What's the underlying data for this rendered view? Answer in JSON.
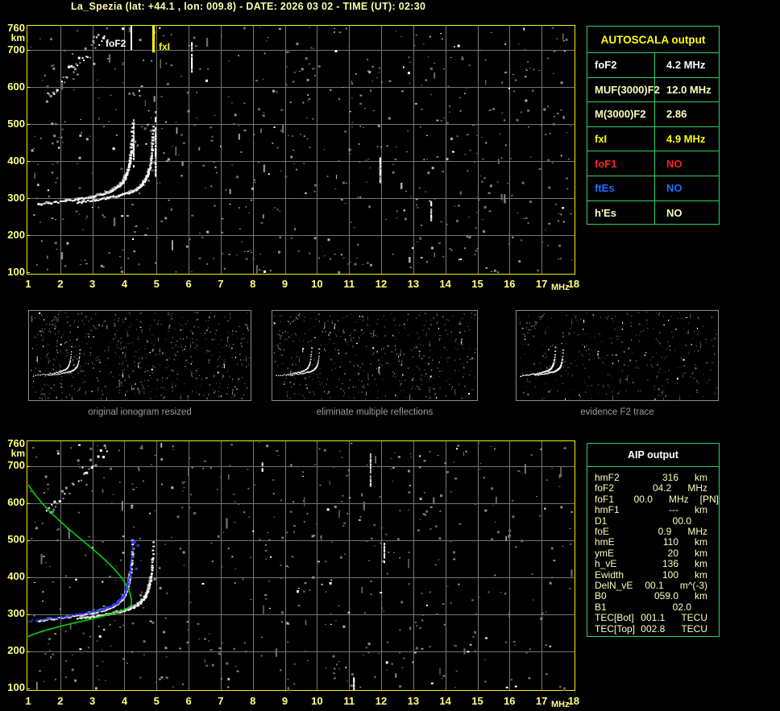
{
  "title": "La_Spezia (lat: +44.1 , lon: 009.8) - DATE: 2026 03 02 - TIME (UT): 02:30",
  "axes": {
    "x_unit": "MHz",
    "y_unit": "km",
    "x_ticks": [
      "1",
      "2",
      "3",
      "4",
      "5",
      "6",
      "7",
      "8",
      "9",
      "10",
      "11",
      "12",
      "13",
      "14",
      "15",
      "16",
      "17",
      "18"
    ],
    "y_ticks": [
      "760",
      "700",
      "600",
      "500",
      "400",
      "300",
      "200",
      "100"
    ]
  },
  "markers": {
    "foF2_label": "foF2",
    "fxI_label": "fxI",
    "foF2_freq_mhz": 4.2,
    "fxI_freq_mhz": 4.9
  },
  "autoscala": {
    "header": "AUTOSCALA output",
    "rows": [
      {
        "label": "foF2",
        "value": "4.2 MHz",
        "color": "#ffffff"
      },
      {
        "label": "MUF(3000)F2",
        "value": "12.0 MHz",
        "color": "#ffffbb"
      },
      {
        "label": "M(3000)F2",
        "value": "2.86",
        "color": "#ffffbb"
      },
      {
        "label": "fxI",
        "value": "4.9 MHz",
        "color": "#ffff00"
      },
      {
        "label": "foF1",
        "value": "NO",
        "color": "#ff2222"
      },
      {
        "label": "ftEs",
        "value": "NO",
        "color": "#1e6fff"
      },
      {
        "label": "h'Es",
        "value": "NO",
        "color": "#ffffbb"
      }
    ]
  },
  "thumbnails": [
    {
      "caption": "original ionogram resized"
    },
    {
      "caption": "eliminate multiple reflections"
    },
    {
      "caption": "evidence F2 trace"
    }
  ],
  "aip": {
    "header": "AIP output",
    "rows": [
      {
        "label": "hmF2",
        "value": "316",
        "unit": "km",
        "extra": ""
      },
      {
        "label": "foF2",
        "value": "04.2",
        "unit": "MHz",
        "extra": ""
      },
      {
        "label": "foF1",
        "value": "00.0",
        "unit": "MHz",
        "extra": "[PN]"
      },
      {
        "label": "hmF1",
        "value": "---",
        "unit": "km",
        "extra": ""
      },
      {
        "label": "D1",
        "value": "00.0",
        "unit": "",
        "extra": ""
      },
      {
        "label": "foE",
        "value": "0.9",
        "unit": "MHz",
        "extra": ""
      },
      {
        "label": "hmE",
        "value": "110",
        "unit": "km",
        "extra": ""
      },
      {
        "label": "ymE",
        "value": "20",
        "unit": "km",
        "extra": ""
      },
      {
        "label": "h_vE",
        "value": "136",
        "unit": "km",
        "extra": ""
      },
      {
        "label": "Ewidth",
        "value": "100",
        "unit": "km",
        "extra": ""
      },
      {
        "label": "DelN_vE",
        "value": "00.1",
        "unit": "m^(-3)",
        "extra": ""
      },
      {
        "label": "B0",
        "value": "059.0",
        "unit": "km",
        "extra": ""
      },
      {
        "label": "B1",
        "value": "02.0",
        "unit": "",
        "extra": ""
      },
      {
        "label": "TEC[Bot]",
        "value": "001.1",
        "unit": "TECU",
        "extra": ""
      },
      {
        "label": "TEC[Top]",
        "value": "002.8",
        "unit": "TECU",
        "extra": ""
      }
    ]
  },
  "bottom_plot": {
    "profile_curve_color": "#00d200",
    "restored_trace_color": "#2b3cf0",
    "profile_peak_mhz": 4.2,
    "profile_peak_km": 316
  },
  "colors": {
    "plot_border": "#f0f000",
    "grid": "#747474",
    "table_border": "#2fd06a",
    "autoscala_header": "#ffff00",
    "aip_header": "#ffffff",
    "axis_label": "#ffff88",
    "title": "#ffffaa",
    "caption": "#9b9b9b"
  }
}
